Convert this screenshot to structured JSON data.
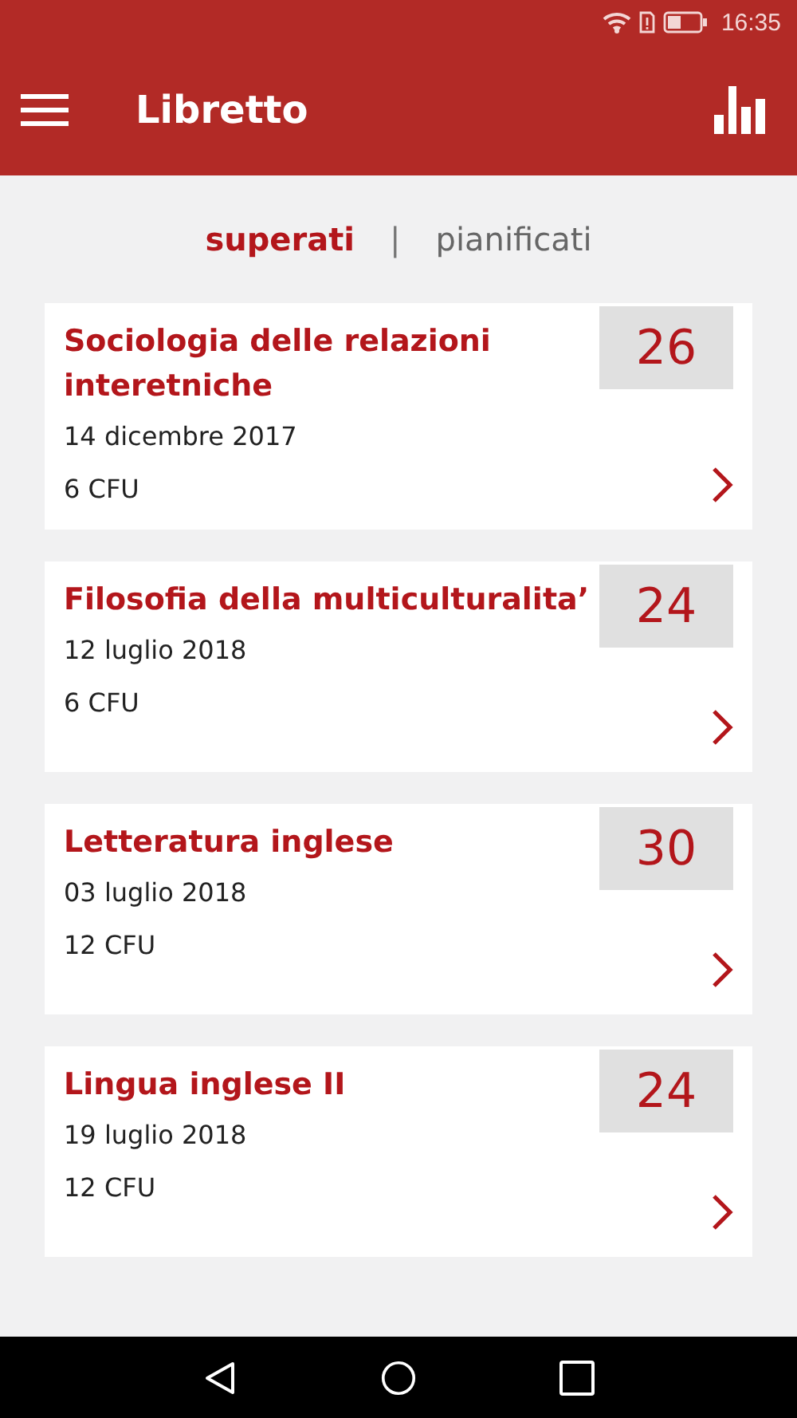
{
  "status_bar": {
    "time": "16:35"
  },
  "header": {
    "title": "Libretto"
  },
  "tabs": [
    {
      "label": "superati",
      "selected": true
    },
    {
      "label": "pianificati",
      "selected": false
    }
  ],
  "tab_separator": "|",
  "exams": [
    {
      "name": "Sociologia delle relazioni interetniche",
      "date": "14 dicembre 2017",
      "credits": "6 CFU",
      "grade": "26"
    },
    {
      "name": "Filosofia della multiculturalita’",
      "date": "12 luglio 2018",
      "credits": "6 CFU",
      "grade": "24"
    },
    {
      "name": "Letteratura inglese",
      "date": "03 luglio 2018",
      "credits": "12 CFU",
      "grade": "30"
    },
    {
      "name": "Lingua inglese II",
      "date": "19 luglio 2018",
      "credits": "12 CFU",
      "grade": "24"
    }
  ]
}
